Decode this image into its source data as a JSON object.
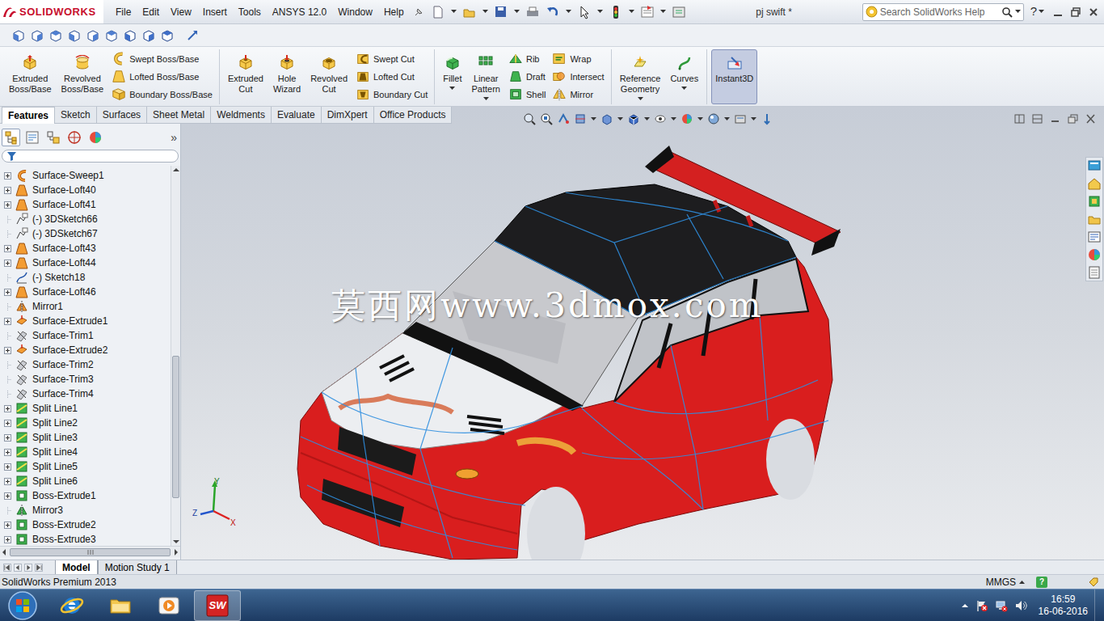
{
  "app": {
    "logo": "SOLIDWORKS",
    "title": "pj swift *"
  },
  "menu": [
    "File",
    "Edit",
    "View",
    "Insert",
    "Tools",
    "ANSYS 12.0",
    "Window",
    "Help"
  ],
  "search": {
    "placeholder": "Search SolidWorks Help"
  },
  "help": "?",
  "ribbon": [
    {
      "columns": [
        {
          "kind": "large",
          "items": [
            {
              "label": "Extruded Boss/Base",
              "kind": "extrude-boss",
              "selected": false,
              "dropdown": false
            }
          ]
        },
        {
          "kind": "large",
          "items": [
            {
              "label": "Revolved Boss/Base",
              "kind": "revolve-boss",
              "selected": false,
              "dropdown": false
            }
          ]
        },
        {
          "kind": "stack",
          "items": [
            {
              "label": "Swept Boss/Base",
              "kind": "sweep-boss",
              "selected": false,
              "dropdown": false
            },
            {
              "label": "Lofted Boss/Base",
              "kind": "loft-boss",
              "selected": false,
              "dropdown": false
            },
            {
              "label": "Boundary Boss/Base",
              "kind": "boundary-boss",
              "selected": false,
              "dropdown": false
            }
          ]
        }
      ]
    },
    {
      "columns": [
        {
          "kind": "large",
          "items": [
            {
              "label": "Extruded Cut",
              "kind": "extrude-cut",
              "selected": false,
              "dropdown": false
            }
          ]
        },
        {
          "kind": "large",
          "items": [
            {
              "label": "Hole Wizard",
              "kind": "hole",
              "selected": false,
              "dropdown": false
            }
          ]
        },
        {
          "kind": "large",
          "items": [
            {
              "label": "Revolved Cut",
              "kind": "revolve-cut",
              "selected": false,
              "dropdown": false
            }
          ]
        },
        {
          "kind": "stack",
          "items": [
            {
              "label": "Swept Cut",
              "kind": "sweep-cut",
              "selected": false,
              "dropdown": false
            },
            {
              "label": "Lofted Cut",
              "kind": "loft-cut",
              "selected": false,
              "dropdown": false
            },
            {
              "label": "Boundary Cut",
              "kind": "boundary-cut",
              "selected": false,
              "dropdown": false
            }
          ]
        }
      ]
    },
    {
      "columns": [
        {
          "kind": "large",
          "items": [
            {
              "label": "Fillet",
              "kind": "fillet",
              "selected": false,
              "dropdown": true
            }
          ]
        },
        {
          "kind": "large",
          "items": [
            {
              "label": "Linear Pattern",
              "kind": "pattern",
              "selected": false,
              "dropdown": true
            }
          ]
        },
        {
          "kind": "stack",
          "items": [
            {
              "label": "Rib",
              "kind": "rib",
              "selected": false,
              "dropdown": false
            },
            {
              "label": "Draft",
              "kind": "draft",
              "selected": false,
              "dropdown": false
            },
            {
              "label": "Shell",
              "kind": "shell",
              "selected": false,
              "dropdown": false
            }
          ]
        },
        {
          "kind": "stack",
          "items": [
            {
              "label": "Wrap",
              "kind": "wrap",
              "selected": false,
              "dropdown": false
            },
            {
              "label": "Intersect",
              "kind": "intersect",
              "selected": false,
              "dropdown": false
            },
            {
              "label": "Mirror",
              "kind": "mirror",
              "selected": false,
              "dropdown": false
            }
          ]
        }
      ]
    },
    {
      "columns": [
        {
          "kind": "large",
          "items": [
            {
              "label": "Reference Geometry",
              "kind": "refgeom",
              "selected": false,
              "dropdown": true
            }
          ]
        },
        {
          "kind": "large",
          "items": [
            {
              "label": "Curves",
              "kind": "curves",
              "selected": false,
              "dropdown": true
            }
          ]
        }
      ]
    },
    {
      "columns": [
        {
          "kind": "large",
          "items": [
            {
              "label": "Instant3D",
              "kind": "instant3d",
              "selected": true,
              "dropdown": false
            }
          ]
        }
      ]
    }
  ],
  "command_tabs": [
    {
      "label": "Features",
      "selected": true
    },
    {
      "label": "Sketch",
      "selected": false
    },
    {
      "label": "Surfaces",
      "selected": false
    },
    {
      "label": "Sheet Metal",
      "selected": false
    },
    {
      "label": "Weldments",
      "selected": false
    },
    {
      "label": "Evaluate",
      "selected": false
    },
    {
      "label": "DimXpert",
      "selected": false
    },
    {
      "label": "Office Products",
      "selected": false
    }
  ],
  "panel": {
    "tabs": [
      {
        "kind": "feature-tree",
        "selected": true
      },
      {
        "kind": "property",
        "selected": false
      },
      {
        "kind": "config",
        "selected": false
      },
      {
        "kind": "dimxpert",
        "selected": false
      },
      {
        "kind": "display",
        "selected": false
      }
    ],
    "more": "»"
  },
  "tree": {
    "items": [
      {
        "label": "Surface-Sweep1",
        "kind": "sweep",
        "has_children": true
      },
      {
        "label": "Surface-Loft40",
        "kind": "loft",
        "has_children": true
      },
      {
        "label": "Surface-Loft41",
        "kind": "loft",
        "has_children": true
      },
      {
        "label": "(-) 3DSketch66",
        "kind": "sketch3d",
        "has_children": false
      },
      {
        "label": "(-) 3DSketch67",
        "kind": "sketch3d",
        "has_children": false
      },
      {
        "label": "Surface-Loft43",
        "kind": "loft",
        "has_children": true
      },
      {
        "label": "Surface-Loft44",
        "kind": "loft",
        "has_children": true
      },
      {
        "label": "(-) Sketch18",
        "kind": "sketch",
        "has_children": false
      },
      {
        "label": "Surface-Loft46",
        "kind": "loft",
        "has_children": true
      },
      {
        "label": "Mirror1",
        "kind": "mirror",
        "has_children": false
      },
      {
        "label": "Surface-Extrude1",
        "kind": "surface-extrude",
        "has_children": true
      },
      {
        "label": "Surface-Trim1",
        "kind": "trim",
        "has_children": false
      },
      {
        "label": "Surface-Extrude2",
        "kind": "surface-extrude",
        "has_children": true
      },
      {
        "label": "Surface-Trim2",
        "kind": "trim",
        "has_children": false
      },
      {
        "label": "Surface-Trim3",
        "kind": "trim",
        "has_children": false
      },
      {
        "label": "Surface-Trim4",
        "kind": "trim",
        "has_children": false
      },
      {
        "label": "Split Line1",
        "kind": "split",
        "has_children": true
      },
      {
        "label": "Split Line2",
        "kind": "split",
        "has_children": true
      },
      {
        "label": "Split Line3",
        "kind": "split",
        "has_children": true
      },
      {
        "label": "Split Line4",
        "kind": "split",
        "has_children": true
      },
      {
        "label": "Split Line5",
        "kind": "split",
        "has_children": true
      },
      {
        "label": "Split Line6",
        "kind": "split",
        "has_children": true
      },
      {
        "label": "Boss-Extrude1",
        "kind": "boss",
        "has_children": true
      },
      {
        "label": "Mirror3",
        "kind": "mirror-body",
        "has_children": false
      },
      {
        "label": "Boss-Extrude2",
        "kind": "boss",
        "has_children": true
      },
      {
        "label": "Boss-Extrude3",
        "kind": "boss",
        "has_children": true
      }
    ],
    "scroll": {
      "thumb_start": 0.5,
      "thumb_size": 0.39
    }
  },
  "viewport": {
    "watermark": "莫西网www.3dmox.com",
    "triad": {
      "x": "X",
      "y": "Y",
      "z": "Z"
    }
  },
  "bottom_tabs": [
    {
      "label": "Model",
      "selected": true
    },
    {
      "label": "Motion Study 1",
      "selected": false
    }
  ],
  "status": {
    "product": "SolidWorks Premium 2013",
    "units": "MMGS",
    "help_glyph": "?"
  },
  "taskbar": {
    "apps": [
      {
        "kind": "ie",
        "label": "",
        "selected": false
      },
      {
        "kind": "explorer",
        "label": "",
        "selected": false
      },
      {
        "kind": "media",
        "label": "",
        "selected": false
      },
      {
        "kind": "solidworks",
        "label": "SW",
        "selected": true
      }
    ],
    "time": "16:59",
    "date": "16-06-2016"
  }
}
